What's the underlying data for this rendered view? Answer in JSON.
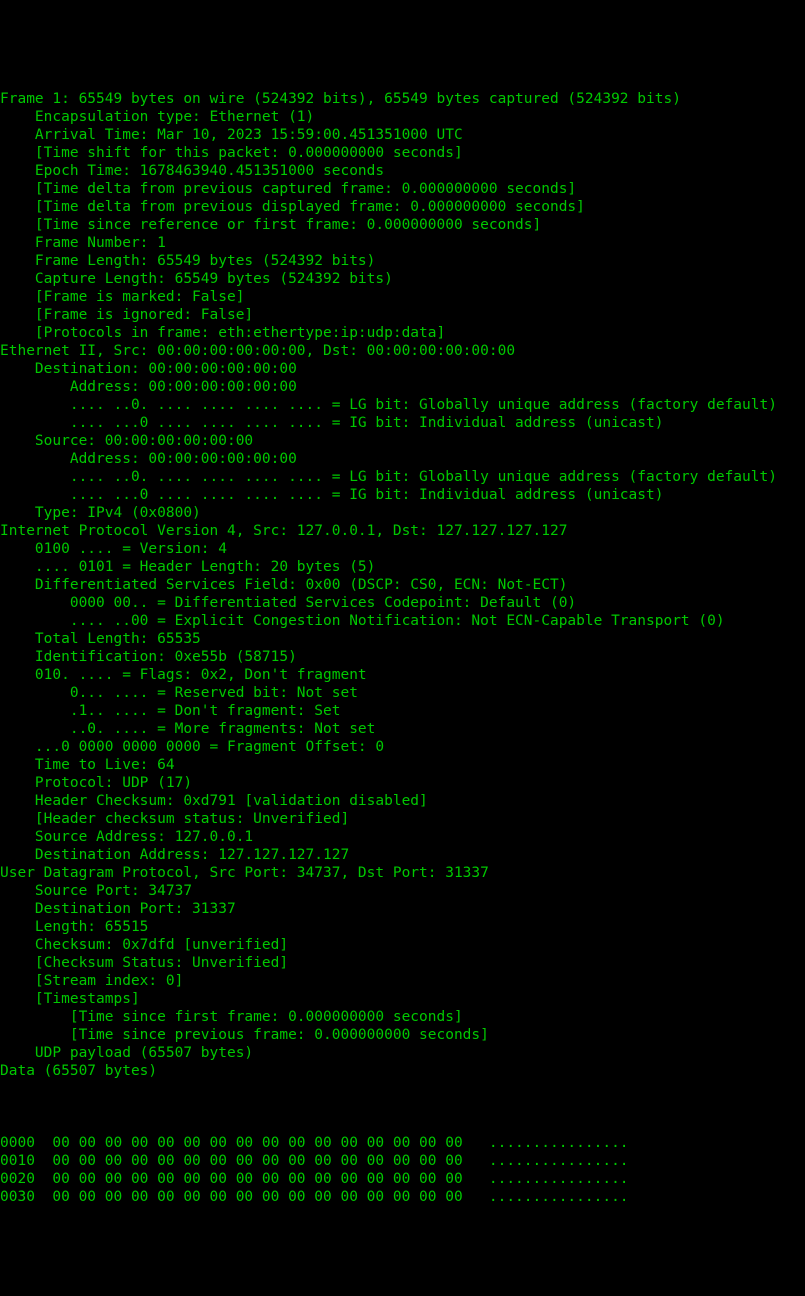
{
  "lines": [
    {
      "indent": 0,
      "text": "Frame 1: 65549 bytes on wire (524392 bits), 65549 bytes captured (524392 bits)"
    },
    {
      "indent": 1,
      "text": "Encapsulation type: Ethernet (1)"
    },
    {
      "indent": 1,
      "text": "Arrival Time: Mar 10, 2023 15:59:00.451351000 UTC"
    },
    {
      "indent": 1,
      "text": "[Time shift for this packet: 0.000000000 seconds]"
    },
    {
      "indent": 1,
      "text": "Epoch Time: 1678463940.451351000 seconds"
    },
    {
      "indent": 1,
      "text": "[Time delta from previous captured frame: 0.000000000 seconds]"
    },
    {
      "indent": 1,
      "text": "[Time delta from previous displayed frame: 0.000000000 seconds]"
    },
    {
      "indent": 1,
      "text": "[Time since reference or first frame: 0.000000000 seconds]"
    },
    {
      "indent": 1,
      "text": "Frame Number: 1"
    },
    {
      "indent": 1,
      "text": "Frame Length: 65549 bytes (524392 bits)"
    },
    {
      "indent": 1,
      "text": "Capture Length: 65549 bytes (524392 bits)"
    },
    {
      "indent": 1,
      "text": "[Frame is marked: False]"
    },
    {
      "indent": 1,
      "text": "[Frame is ignored: False]"
    },
    {
      "indent": 1,
      "text": "[Protocols in frame: eth:ethertype:ip:udp:data]"
    },
    {
      "indent": 0,
      "text": "Ethernet II, Src: 00:00:00:00:00:00, Dst: 00:00:00:00:00:00"
    },
    {
      "indent": 1,
      "text": "Destination: 00:00:00:00:00:00"
    },
    {
      "indent": 2,
      "text": "Address: 00:00:00:00:00:00"
    },
    {
      "indent": 2,
      "text": ".... ..0. .... .... .... .... = LG bit: Globally unique address (factory default)"
    },
    {
      "indent": 2,
      "text": ".... ...0 .... .... .... .... = IG bit: Individual address (unicast)"
    },
    {
      "indent": 1,
      "text": "Source: 00:00:00:00:00:00"
    },
    {
      "indent": 2,
      "text": "Address: 00:00:00:00:00:00"
    },
    {
      "indent": 2,
      "text": ".... ..0. .... .... .... .... = LG bit: Globally unique address (factory default)"
    },
    {
      "indent": 2,
      "text": ".... ...0 .... .... .... .... = IG bit: Individual address (unicast)"
    },
    {
      "indent": 1,
      "text": "Type: IPv4 (0x0800)"
    },
    {
      "indent": 0,
      "text": "Internet Protocol Version 4, Src: 127.0.0.1, Dst: 127.127.127.127"
    },
    {
      "indent": 1,
      "text": "0100 .... = Version: 4"
    },
    {
      "indent": 1,
      "text": ".... 0101 = Header Length: 20 bytes (5)"
    },
    {
      "indent": 1,
      "text": "Differentiated Services Field: 0x00 (DSCP: CS0, ECN: Not-ECT)"
    },
    {
      "indent": 2,
      "text": "0000 00.. = Differentiated Services Codepoint: Default (0)"
    },
    {
      "indent": 2,
      "text": ".... ..00 = Explicit Congestion Notification: Not ECN-Capable Transport (0)"
    },
    {
      "indent": 1,
      "text": "Total Length: 65535"
    },
    {
      "indent": 1,
      "text": "Identification: 0xe55b (58715)"
    },
    {
      "indent": 1,
      "text": "010. .... = Flags: 0x2, Don't fragment"
    },
    {
      "indent": 2,
      "text": "0... .... = Reserved bit: Not set"
    },
    {
      "indent": 2,
      "text": ".1.. .... = Don't fragment: Set"
    },
    {
      "indent": 2,
      "text": "..0. .... = More fragments: Not set"
    },
    {
      "indent": 1,
      "text": "...0 0000 0000 0000 = Fragment Offset: 0"
    },
    {
      "indent": 1,
      "text": "Time to Live: 64"
    },
    {
      "indent": 1,
      "text": "Protocol: UDP (17)"
    },
    {
      "indent": 1,
      "text": "Header Checksum: 0xd791 [validation disabled]"
    },
    {
      "indent": 1,
      "text": "[Header checksum status: Unverified]"
    },
    {
      "indent": 1,
      "text": "Source Address: 127.0.0.1"
    },
    {
      "indent": 1,
      "text": "Destination Address: 127.127.127.127"
    },
    {
      "indent": 0,
      "text": "User Datagram Protocol, Src Port: 34737, Dst Port: 31337"
    },
    {
      "indent": 1,
      "text": "Source Port: 34737"
    },
    {
      "indent": 1,
      "text": "Destination Port: 31337"
    },
    {
      "indent": 1,
      "text": "Length: 65515"
    },
    {
      "indent": 1,
      "text": "Checksum: 0x7dfd [unverified]"
    },
    {
      "indent": 1,
      "text": "[Checksum Status: Unverified]"
    },
    {
      "indent": 1,
      "text": "[Stream index: 0]"
    },
    {
      "indent": 1,
      "text": "[Timestamps]"
    },
    {
      "indent": 2,
      "text": "[Time since first frame: 0.000000000 seconds]"
    },
    {
      "indent": 2,
      "text": "[Time since previous frame: 0.000000000 seconds]"
    },
    {
      "indent": 1,
      "text": "UDP payload (65507 bytes)"
    },
    {
      "indent": 0,
      "text": "Data (65507 bytes)"
    }
  ],
  "hexdump_rows": [
    "0000",
    "0010",
    "0020",
    "0030"
  ],
  "hexdump_bytes": "00 00 00 00 00 00 00 00 00 00 00 00 00 00 00 00",
  "hexdump_ascii": "................"
}
